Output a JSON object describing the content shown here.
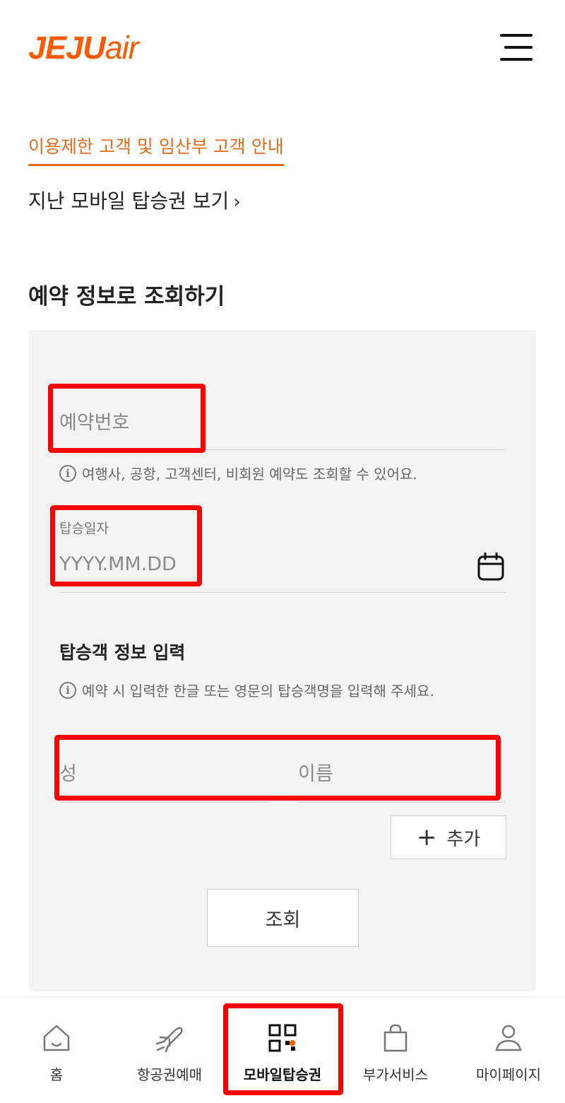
{
  "header": {
    "logo_main": "JEJU",
    "logo_sub": "air",
    "menu_icon": "hamburger-menu-icon"
  },
  "links": {
    "restriction_notice": "이용제한 고객 및 임산부 고객 안내",
    "past_boarding_passes": "지난 모바일 탑승권 보기",
    "chevron": "›"
  },
  "section": {
    "title": "예약 정보로 조회하기"
  },
  "form": {
    "reservation_placeholder": "예약번호",
    "reservation_hint": "여행사, 공항, 고객센터, 비회원 예약도 조회할 수 있어요.",
    "date_label": "탑승일자",
    "date_placeholder": "YYYY.MM.DD",
    "date_icon": "calendar-icon",
    "passenger_title": "탑승객 정보 입력",
    "passenger_hint": "예약 시 입력한 한글 또는 영문의 탑승객명을 입력해 주세요.",
    "last_name_placeholder": "성",
    "first_name_placeholder": "이름",
    "add_label": "추가",
    "search_label": "조회",
    "info_icon_glyph": "i"
  },
  "bottom_nav": {
    "items": [
      {
        "label": "홈",
        "icon": "home-icon"
      },
      {
        "label": "항공권예매",
        "icon": "airplane-icon"
      },
      {
        "label": "모바일탑승권",
        "icon": "qr-code-icon",
        "active": true
      },
      {
        "label": "부가서비스",
        "icon": "shopping-bag-icon"
      },
      {
        "label": "마이페이지",
        "icon": "user-icon"
      }
    ]
  },
  "colors": {
    "brand": "#ff5a00",
    "link_orange": "#e56a1b",
    "highlight_red": "#ff0000",
    "panel_bg": "#f4f4f4"
  }
}
